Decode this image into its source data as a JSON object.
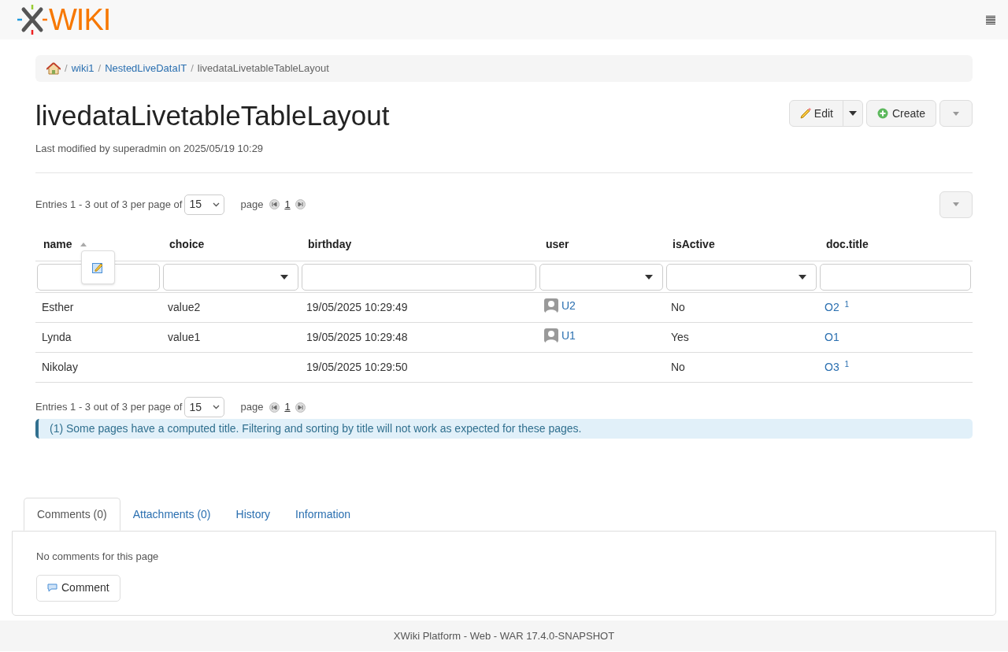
{
  "logo": {
    "text": "WIKI"
  },
  "breadcrumb": [
    {
      "separator": "/",
      "text": "wiki1",
      "link": true
    },
    {
      "separator": "/",
      "text": "NestedLiveDataIT",
      "link": true
    },
    {
      "separator": "/",
      "text": "livedataLivetableTableLayout",
      "link": false
    }
  ],
  "page": {
    "title": "livedataLivetableTableLayout",
    "meta": "Last modified by superadmin on 2025/05/19 10:29"
  },
  "actions": [
    {
      "label": "Edit",
      "kind": "edit"
    },
    {
      "label": "Create",
      "kind": "create"
    }
  ],
  "pagination_top": {
    "entries": "Entries 1 - 3 out of 3 per page of",
    "per_page": "15",
    "page_label": "page",
    "page": "1"
  },
  "table": {
    "columns": [
      {
        "label": "name",
        "sorted": true,
        "kind": "text"
      },
      {
        "label": "choice",
        "sorted": false,
        "kind": "select"
      },
      {
        "label": "birthday",
        "sorted": false,
        "kind": "text"
      },
      {
        "label": "user",
        "sorted": false,
        "kind": "select"
      },
      {
        "label": "isActive",
        "sorted": false,
        "kind": "select"
      },
      {
        "label": "doc.title",
        "sorted": false,
        "kind": "text"
      }
    ],
    "rows": [
      {
        "name": "Esther",
        "choice": "value2",
        "birthday": "19/05/2025 10:29:49",
        "user": "U2",
        "isActive": "No",
        "title": "O2",
        "note": "1"
      },
      {
        "name": "Lynda",
        "choice": "value1",
        "birthday": "19/05/2025 10:29:48",
        "user": "U1",
        "isActive": "Yes",
        "title": "O1",
        "note": ""
      },
      {
        "name": "Nikolay",
        "choice": "",
        "birthday": "19/05/2025 10:29:50",
        "user": "",
        "isActive": "No",
        "title": "O3",
        "note": "1"
      }
    ]
  },
  "pagination_bottom": {
    "entries": "Entries 1 - 3 out of 3 per page of",
    "per_page": "15",
    "page_label": "page",
    "page": "1"
  },
  "footnote": "(1) Some pages have a computed title. Filtering and sorting by title will not work as expected for these pages.",
  "tabs": [
    {
      "label": "Comments (0)",
      "selected": true
    },
    {
      "label": "Attachments (0)",
      "selected": false
    },
    {
      "label": "History",
      "selected": false
    },
    {
      "label": "Information",
      "selected": false
    }
  ],
  "comments": {
    "empty": "No comments for this page",
    "button": "Comment"
  },
  "footer": "XWiki Platform - Web - WAR 17.4.0-SNAPSHOT"
}
